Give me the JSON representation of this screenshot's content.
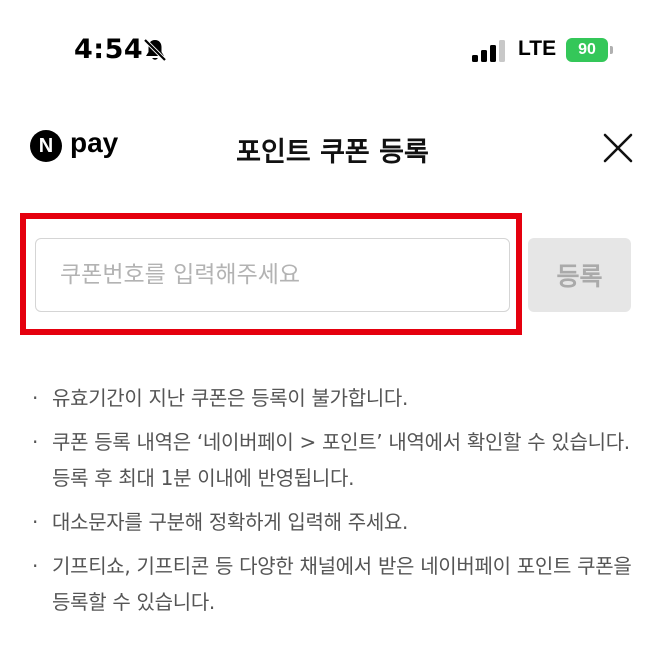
{
  "status_bar": {
    "time": "4:54",
    "network": "LTE",
    "battery": "90"
  },
  "header": {
    "logo_mark": "N",
    "logo_text": "pay",
    "title": "포인트 쿠폰 등록"
  },
  "coupon_form": {
    "placeholder": "쿠폰번호를 입력해주세요",
    "value": "",
    "register_label": "등록"
  },
  "colors": {
    "highlight": "#e5000e",
    "battery": "#34c759",
    "button_disabled_bg": "#e6e6e6"
  },
  "icons": {
    "bell": "bell-slash-icon",
    "signal": "cellular-signal-icon",
    "close": "close-icon"
  },
  "notices": [
    {
      "bullet": "·",
      "text": "유효기간이 지난 쿠폰은 등록이 불가합니다."
    },
    {
      "bullet": "·",
      "text": "쿠폰 등록 내역은 ‘네이버페이 > 포인트’ 내역에서 확인할 수 있습니다. 등록 후 최대 1분 이내에 반영됩니다."
    },
    {
      "bullet": "·",
      "text": "대소문자를 구분해 정확하게 입력해 주세요."
    },
    {
      "bullet": "·",
      "text": "기프티쇼, 기프티콘 등 다양한 채널에서 받은 네이버페이 포인트 쿠폰을 등록할 수 있습니다."
    }
  ]
}
